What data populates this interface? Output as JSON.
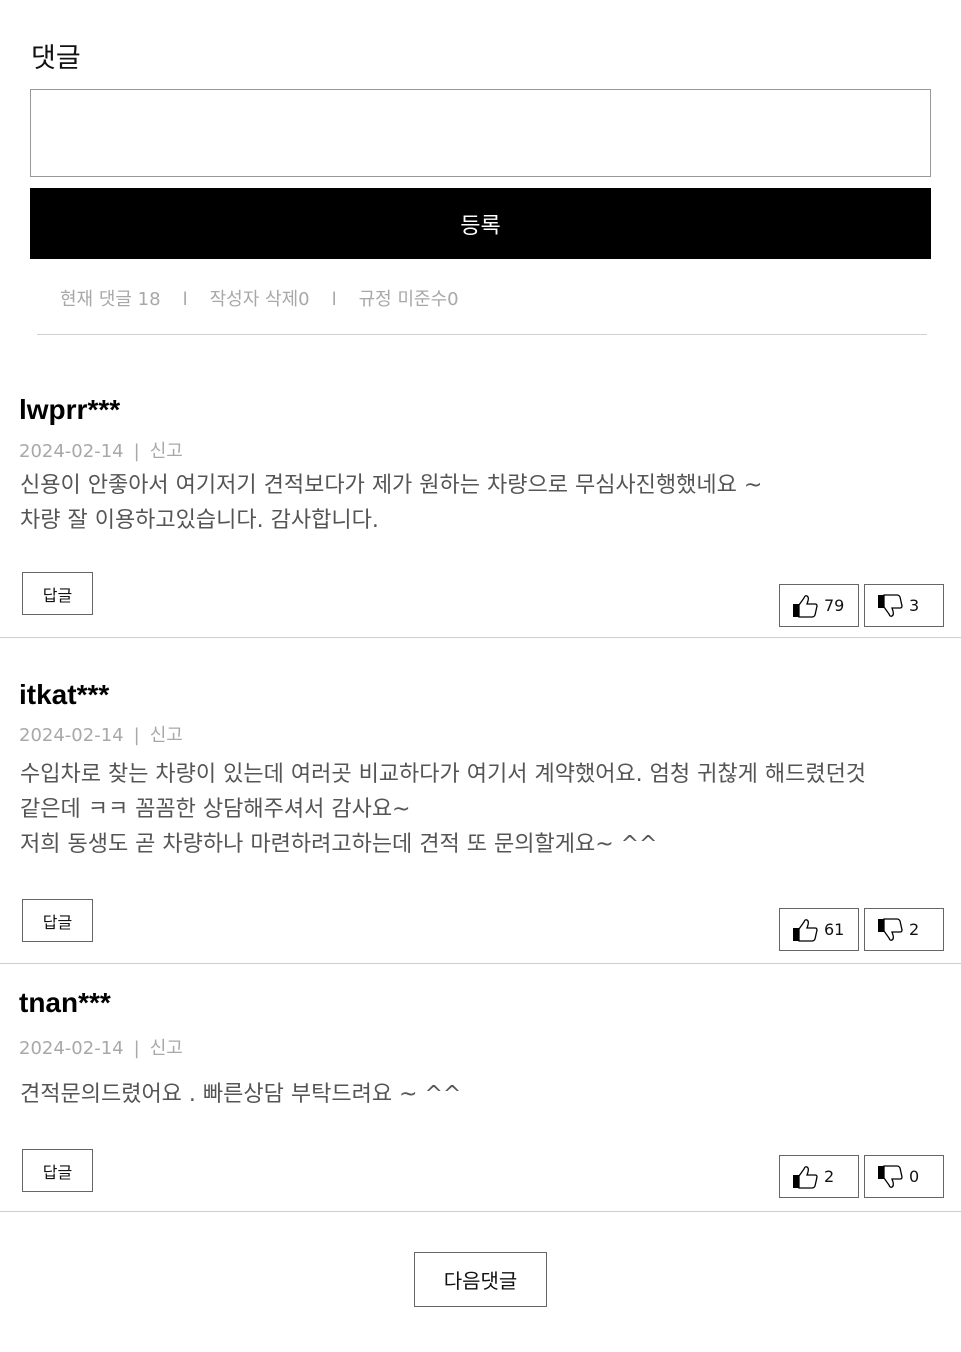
{
  "comment_section": {
    "title": "댓글",
    "input_placeholder": "",
    "submit_label": "등록",
    "stats": {
      "current_comments": "현재 댓글 18",
      "author_deleted": "작성자 삭제0",
      "rule_violations": "규정 미준수0",
      "separator": "l"
    }
  },
  "comments": [
    {
      "author": "lwprr***",
      "date": "2024-02-14",
      "report_label": "신고",
      "lines": [
        "신용이 안좋아서 여기저기 견적보다가 제가 원하는 차량으로 무심사진행했네요 ~",
        "차량 잘 이용하고있습니다. 감사합니다."
      ],
      "reply_label": "답글",
      "likes": "79",
      "dislikes": "3",
      "like_icon": "thumbs-up-icon",
      "dislike_icon": "thumbs-down-icon"
    },
    {
      "author": "itkat***",
      "date": "2024-02-14",
      "report_label": "신고",
      "lines": [
        "수입차로 찾는 차량이 있는데 여러곳 비교하다가 여기서 계약했어요. 엄청 귀찮게 해드렸던것",
        "같은데 ㅋㅋ 꼼꼼한 상담해주셔서 감사요~",
        "저희 동생도 곧 차량하나 마련하려고하는데 견적 또 문의할게요~ ^^"
      ],
      "reply_label": "답글",
      "likes": "61",
      "dislikes": "2",
      "like_icon": "thumbs-up-icon",
      "dislike_icon": "thumbs-down-icon"
    },
    {
      "author": "tnan***",
      "date": "2024-02-14",
      "report_label": "신고",
      "lines": [
        "견적문의드렸어요 . 빠른상담 부탁드려요 ~ ^^"
      ],
      "reply_label": "답글",
      "likes": "2",
      "dislikes": "0",
      "like_icon": "thumbs-up-icon",
      "dislike_icon": "thumbs-down-icon"
    }
  ],
  "pagination": {
    "next_label": "다음댓글"
  },
  "colors": {
    "submit_bg": "#000000",
    "muted_text": "#a8a8a8",
    "body_text": "#555555"
  }
}
